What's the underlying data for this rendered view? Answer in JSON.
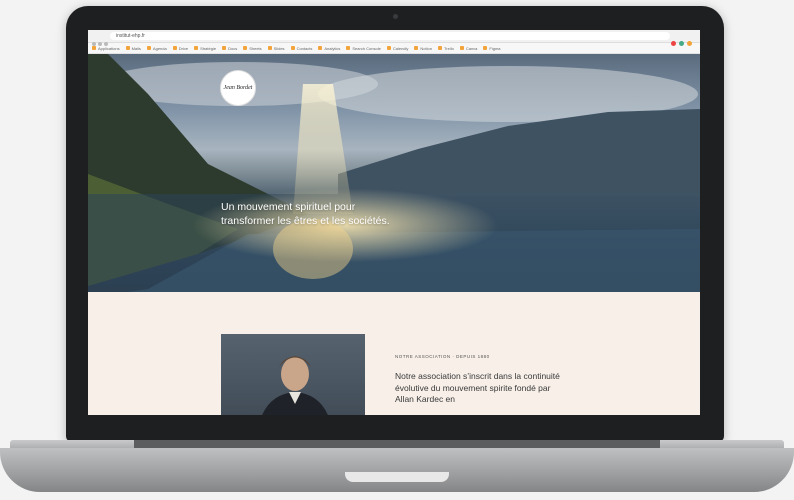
{
  "browser": {
    "address": "institut-ehp.fr",
    "bookmarks": [
      "Applications",
      "Mails",
      "Agenda",
      "Drive",
      "Stratégie",
      "Docs",
      "Sheets",
      "Slides",
      "Contacts",
      "Analytics",
      "Search Console",
      "Calendly",
      "Notion",
      "Trello",
      "Canva",
      "Figma"
    ]
  },
  "site": {
    "logo_text": "Jean Bordet",
    "hero": {
      "headline": "Un mouvement spirituel pour transformer les êtres et les sociétés."
    },
    "section": {
      "kicker": "NOTRE ASSOCIATION · DEPUIS 1880",
      "paragraph": "Notre association s’inscrit dans la continuité évolutive du mouvement spirite fondé par Allan Kardec en"
    }
  },
  "colors": {
    "bezel": "#1e1f21",
    "content_bg": "#f7efe8",
    "accent": "#f2a33a"
  }
}
